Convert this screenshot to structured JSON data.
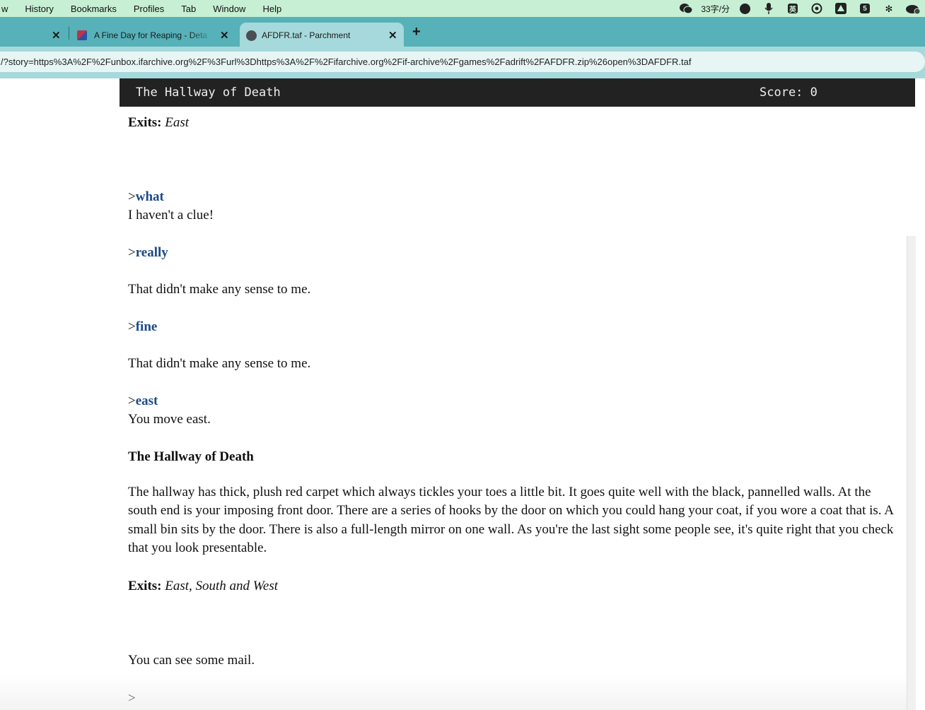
{
  "menubar": {
    "items": [
      "w",
      "History",
      "Bookmarks",
      "Profiles",
      "Tab",
      "Window",
      "Help"
    ],
    "status": {
      "wechat_icon": "wechat-icon",
      "typing_speed": "33字/分",
      "ime_label": "英",
      "battery_label": "5"
    }
  },
  "tabs": [
    {
      "title": "",
      "active": false
    },
    {
      "title": "A Fine Day for Reaping - Deta",
      "active": false
    },
    {
      "title": "AFDFR.taf - Parchment",
      "active": true
    }
  ],
  "address": {
    "url": "/?story=https%3A%2F%2Funbox.ifarchive.org%2F%3Furl%3Dhttps%3A%2F%2Fifarchive.org%2Fif-archive%2Fgames%2Fadrift%2FAFDFR.zip%26open%3DAFDFR.taf"
  },
  "game": {
    "location": "The Hallway of Death",
    "score": "Score: 0"
  },
  "story": {
    "exits1_label": "Exits:",
    "exits1_value": "East",
    "prompt": ">",
    "cmd_what": "what",
    "reply_what": "I haven't a clue!",
    "cmd_really": "really",
    "reply_really": "That didn't make any sense to me.",
    "cmd_fine": "fine",
    "reply_fine": "That didn't make any sense to me.",
    "cmd_east": "east",
    "reply_east": "You move east.",
    "room_title": "The Hallway of Death",
    "room_desc": "The hallway has thick, plush red carpet which always tickles your toes a little bit.  It goes quite well with the black, pannelled walls.  At the south end is your imposing front door.  There are a series of hooks by the door on which you could hang your coat, if you wore a coat that is.  A small bin sits by the door.  There is also a full-length mirror on one wall.  As you're the last sight some people see, it's quite right that you check that you look presentable.",
    "exits2_label": "Exits:",
    "exits2_value": "East, South and West",
    "mail": "You can see some mail.",
    "input_prompt": ">"
  }
}
